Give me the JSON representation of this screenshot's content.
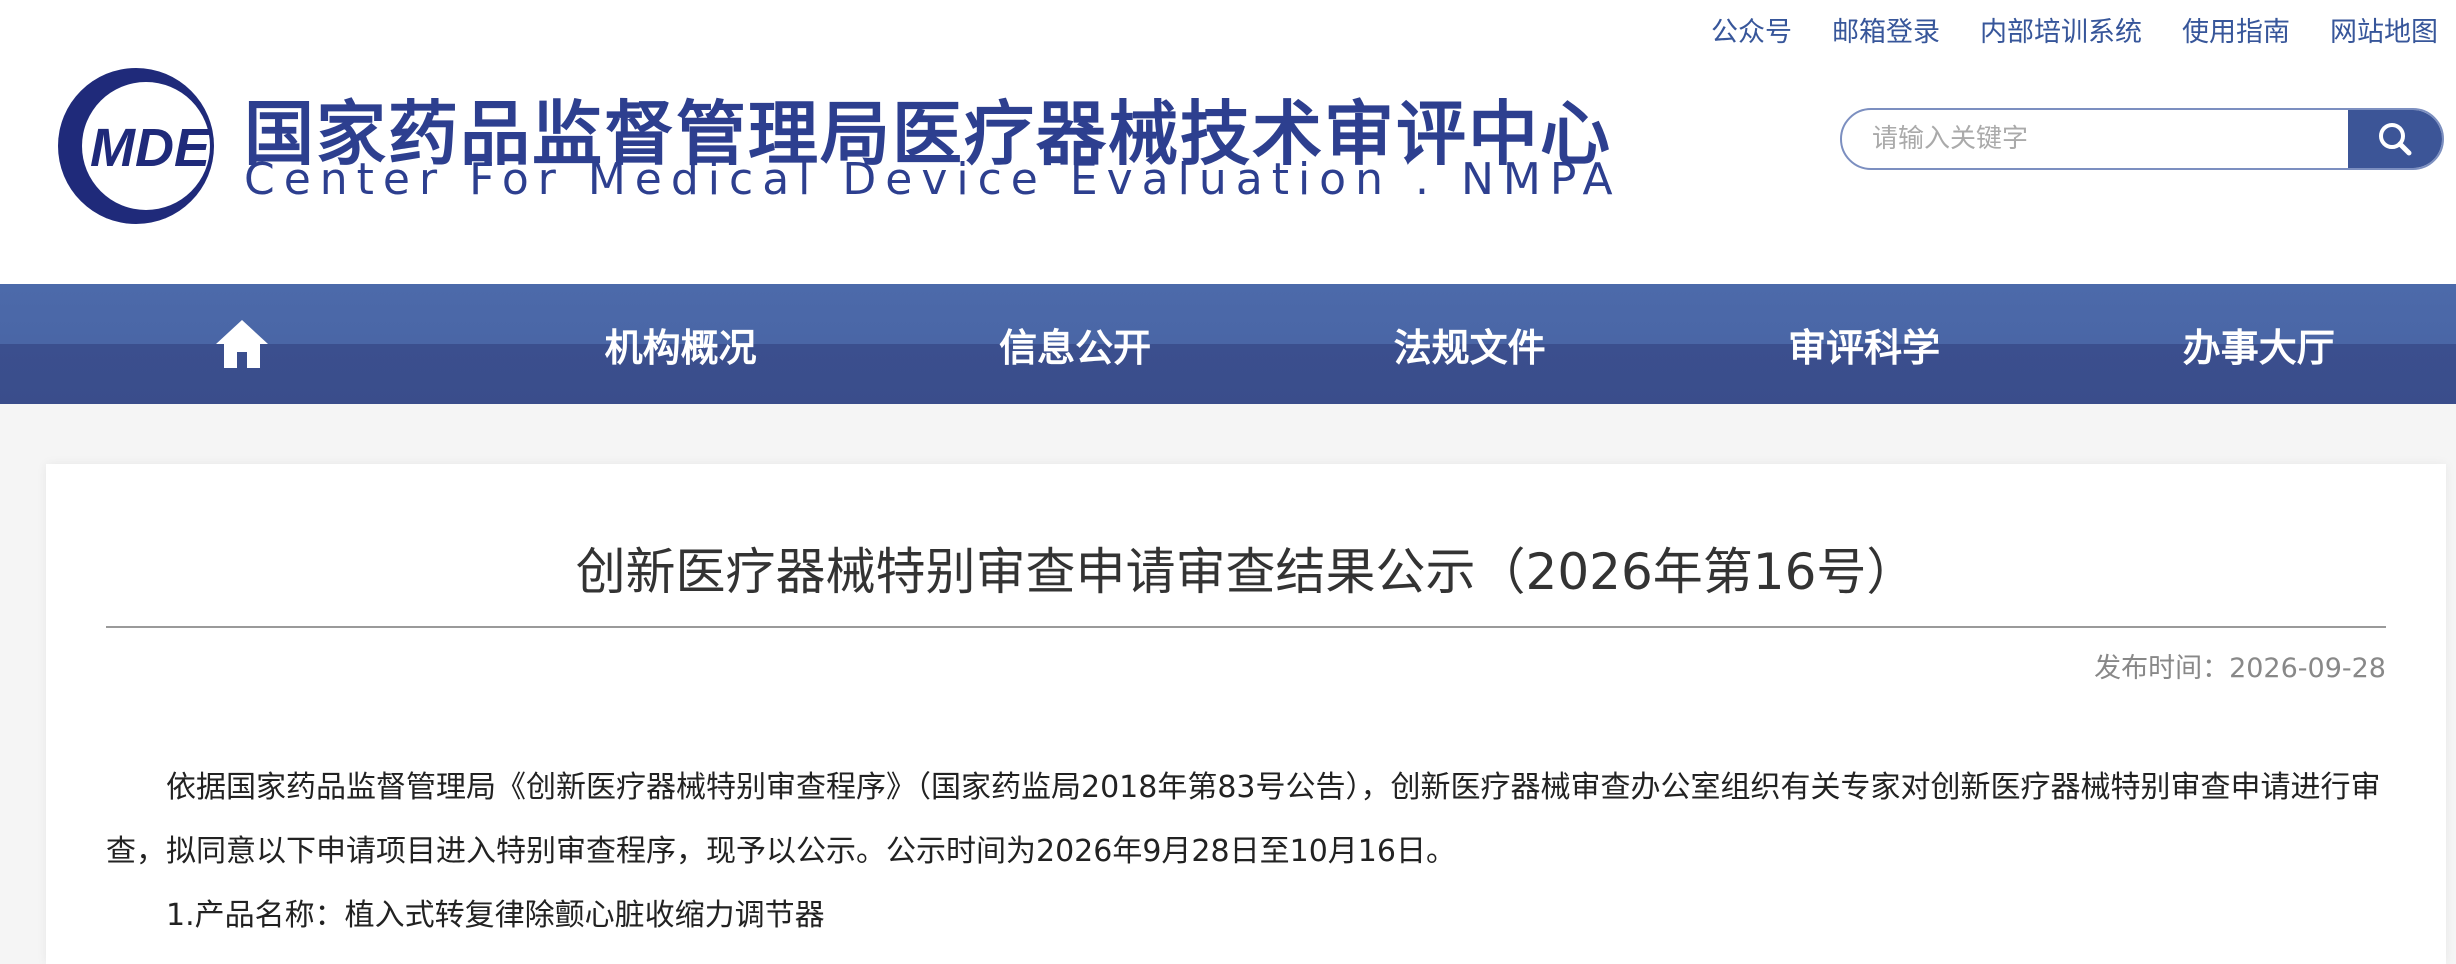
{
  "top_links": [
    "公众号",
    "邮箱登录",
    "内部培训系统",
    "使用指南",
    "网站地图"
  ],
  "header": {
    "logo_text": "MDE",
    "title": "国家药品监督管理局医疗器械技术审评中心",
    "subtitle": "Center For Medical Device Evaluation . NMPA"
  },
  "search": {
    "placeholder": "请输入关键字"
  },
  "nav": {
    "home_icon": "home-icon",
    "items": [
      "机构概况",
      "信息公开",
      "法规文件",
      "审评科学",
      "办事大厅"
    ]
  },
  "article": {
    "title": "创新医疗器械特别审查申请审查结果公示（2026年第16号）",
    "date": "发布时间：2026-09-28",
    "paragraphs": [
      "依据国家药品监督管理局《创新医疗器械特别审查程序》（国家药监局2018年第83号公告），创新医疗器械审查办公室组织有关专家对创新医疗器械特别审查申请进行审查，拟同意以下申请项目进入特别审查程序，现予以公示。公示时间为2026年9月28日至10月16日。",
      "1.产品名称：植入式转复律除颤心脏收缩力调节器"
    ]
  },
  "colors": {
    "brand": "#2d3f8f",
    "nav_top": "#4c6aaa",
    "nav_bottom": "#3b4f8e",
    "link": "#37569a"
  }
}
